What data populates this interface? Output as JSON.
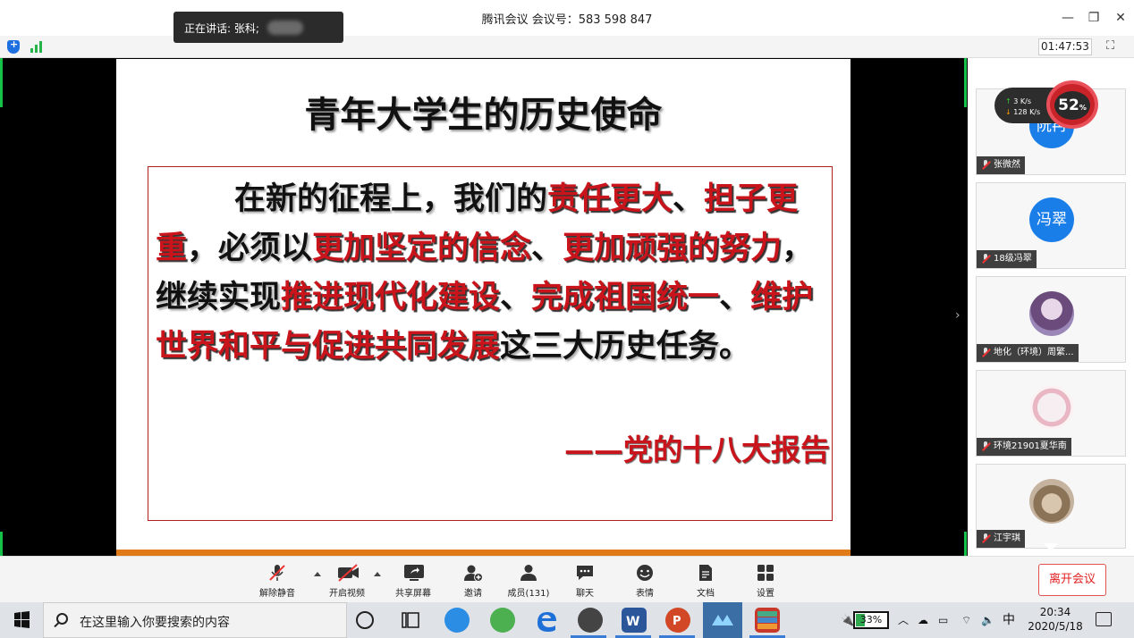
{
  "window": {
    "title": "腾讯会议 会议号：583 598 847",
    "minimize": "—",
    "restore": "❐",
    "close": "✕"
  },
  "speaker": {
    "label": "正在讲话: 张科;"
  },
  "infobar": {
    "timer": "01:47:53"
  },
  "slide": {
    "title": "青年大学生的历史使命",
    "text_parts": [
      {
        "text": "在新的征程上，我们的",
        "style": "normal"
      },
      {
        "text": "责任更大",
        "style": "red"
      },
      {
        "text": "、",
        "style": "normal"
      },
      {
        "text": "担子更重",
        "style": "red"
      },
      {
        "text": "，必须以",
        "style": "normal"
      },
      {
        "text": "更加坚定的信念",
        "style": "red"
      },
      {
        "text": "、",
        "style": "normal"
      },
      {
        "text": "更加顽强的努力",
        "style": "red"
      },
      {
        "text": "，继续实现",
        "style": "normal"
      },
      {
        "text": "推进现代化建设",
        "style": "red"
      },
      {
        "text": "、",
        "style": "normal"
      },
      {
        "text": "完成祖国统一",
        "style": "red"
      },
      {
        "text": "、",
        "style": "normal"
      },
      {
        "text": "维护世界和平与促进共同发展",
        "style": "red"
      },
      {
        "text": "这三大历史任务。",
        "style": "normal"
      }
    ],
    "source": "——党的十八大报告"
  },
  "netwidget": {
    "upload": "3  K/s",
    "download": "128 K/s",
    "cpu": "52",
    "cpu_unit": "%"
  },
  "participants": [
    {
      "name": "张微然",
      "avatar_text": "阮冉",
      "avatar_type": "blue"
    },
    {
      "name": "18级冯翠",
      "avatar_text": "冯翠",
      "avatar_type": "blue"
    },
    {
      "name": "地化（环境）周繁...",
      "avatar_text": "",
      "avatar_type": "photo-purple"
    },
    {
      "name": "环境21901夏华南",
      "avatar_text": "",
      "avatar_type": "photo-pink"
    },
    {
      "name": "江宇琪",
      "avatar_text": "",
      "avatar_type": "photo-cat"
    }
  ],
  "toolbar": {
    "unmute": "解除静音",
    "start_video": "开启视频",
    "share_screen": "共享屏幕",
    "invite": "邀请",
    "members": "成员(131)",
    "chat": "聊天",
    "emoji": "表情",
    "docs": "文档",
    "settings": "设置",
    "leave": "离开会议"
  },
  "taskbar": {
    "search_placeholder": "在这里输入你要搜索的内容",
    "battery": "33%",
    "ime": "中",
    "time": "20:34",
    "date": "2020/5/18"
  },
  "colors": {
    "accent_green": "#16c14a",
    "slide_red": "#c8141a",
    "stripe_orange": "#e07a18",
    "leave_red": "#e02020",
    "avatar_blue": "#1a7ee8"
  }
}
